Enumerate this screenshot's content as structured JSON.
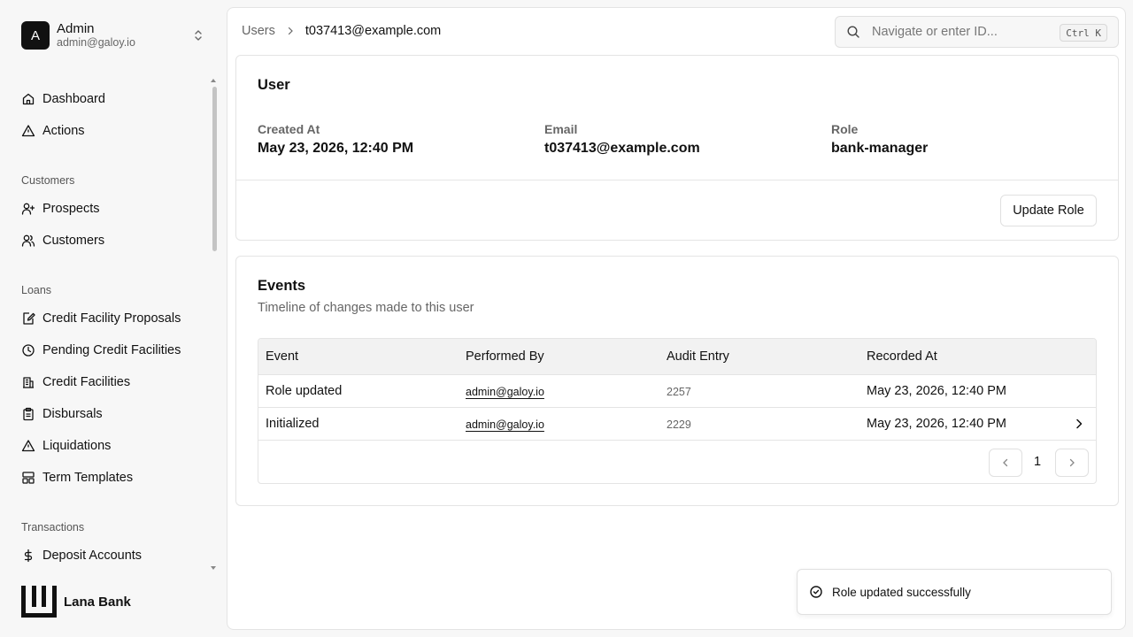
{
  "account": {
    "initial": "A",
    "name": "Admin",
    "email": "admin@galoy.io"
  },
  "nav": {
    "dashboard": "Dashboard",
    "actions": "Actions",
    "section_customers": "Customers",
    "prospects": "Prospects",
    "customers": "Customers",
    "section_loans": "Loans",
    "credit_facility_proposals": "Credit Facility Proposals",
    "pending_credit_facilities": "Pending Credit Facilities",
    "credit_facilities": "Credit Facilities",
    "disbursals": "Disbursals",
    "liquidations": "Liquidations",
    "term_templates": "Term Templates",
    "section_transactions": "Transactions",
    "deposit_accounts": "Deposit Accounts"
  },
  "brand": {
    "name": "Lana Bank"
  },
  "breadcrumb": {
    "parent": "Users",
    "current": "t037413@example.com"
  },
  "search": {
    "placeholder": "Navigate or enter ID...",
    "shortcut": "Ctrl K"
  },
  "user_card": {
    "title": "User",
    "created_at_label": "Created At",
    "created_at_value": "May 23, 2026, 12:40 PM",
    "email_label": "Email",
    "email_value": "t037413@example.com",
    "role_label": "Role",
    "role_value": "bank-manager",
    "update_role_label": "Update Role"
  },
  "events": {
    "title": "Events",
    "subtitle": "Timeline of changes made to this user",
    "columns": {
      "event": "Event",
      "performed_by": "Performed By",
      "audit_entry": "Audit Entry",
      "recorded_at": "Recorded At"
    },
    "rows": [
      {
        "event": "Role updated",
        "performed_by": "admin@galoy.io",
        "audit_entry": "2257",
        "recorded_at": "May 23, 2026, 12:40 PM"
      },
      {
        "event": "Initialized",
        "performed_by": "admin@galoy.io",
        "audit_entry": "2229",
        "recorded_at": "May 23, 2026, 12:40 PM"
      }
    ],
    "page": "1"
  },
  "toast": {
    "message": "Role updated successfully"
  }
}
